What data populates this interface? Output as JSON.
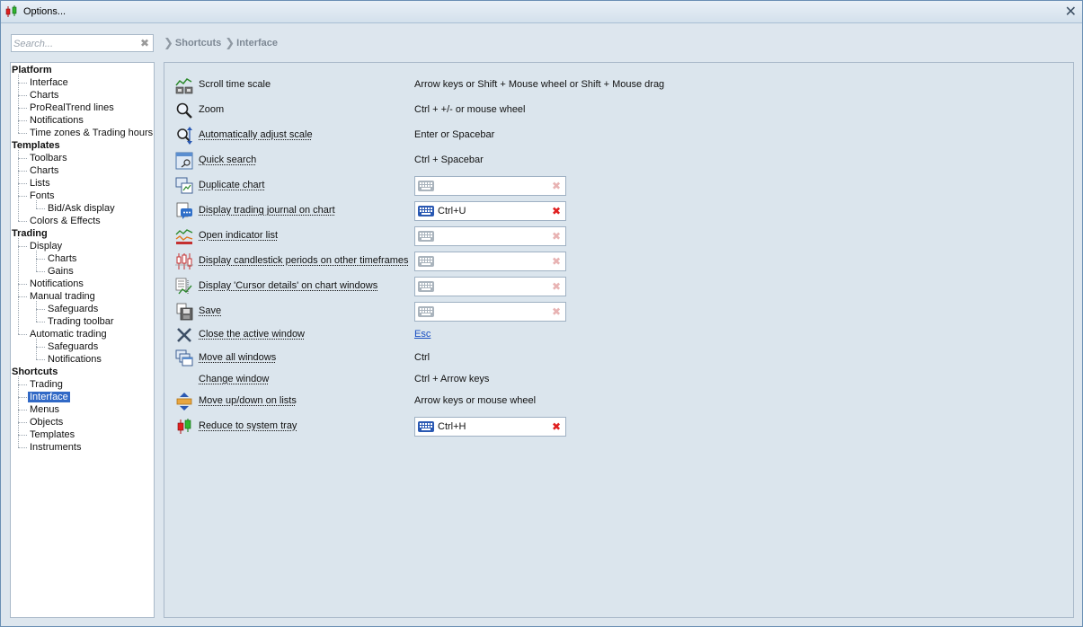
{
  "window": {
    "title": "Options..."
  },
  "search": {
    "placeholder": "Search..."
  },
  "breadcrumb": [
    "Shortcuts",
    "Interface"
  ],
  "tree": [
    {
      "label": "Platform",
      "level": 0
    },
    {
      "label": "Interface",
      "level": 1
    },
    {
      "label": "Charts",
      "level": 1
    },
    {
      "label": "ProRealTrend lines",
      "level": 1
    },
    {
      "label": "Notifications",
      "level": 1
    },
    {
      "label": "Time zones & Trading hours",
      "level": 1
    },
    {
      "label": "Templates",
      "level": 0
    },
    {
      "label": "Toolbars",
      "level": 1
    },
    {
      "label": "Charts",
      "level": 1
    },
    {
      "label": "Lists",
      "level": 1
    },
    {
      "label": "Fonts",
      "level": 1
    },
    {
      "label": "Bid/Ask display",
      "level": 2
    },
    {
      "label": "Colors & Effects",
      "level": 1
    },
    {
      "label": "Trading",
      "level": 0
    },
    {
      "label": "Display",
      "level": 1
    },
    {
      "label": "Charts",
      "level": 2
    },
    {
      "label": "Gains",
      "level": 2
    },
    {
      "label": "Notifications",
      "level": 1
    },
    {
      "label": "Manual trading",
      "level": 1
    },
    {
      "label": "Safeguards",
      "level": 2
    },
    {
      "label": "Trading toolbar",
      "level": 2
    },
    {
      "label": "Automatic trading",
      "level": 1
    },
    {
      "label": "Safeguards",
      "level": 2
    },
    {
      "label": "Notifications",
      "level": 2
    },
    {
      "label": "Shortcuts",
      "level": 0
    },
    {
      "label": "Trading",
      "level": 1
    },
    {
      "label": "Interface",
      "level": 1,
      "selected": true
    },
    {
      "label": "Menus",
      "level": 1
    },
    {
      "label": "Objects",
      "level": 1
    },
    {
      "label": "Templates",
      "level": 1
    },
    {
      "label": "Instruments",
      "level": 1
    }
  ],
  "shortcuts": [
    {
      "label": "Scroll time scale",
      "link": false,
      "icon": "scroll-time-scale-icon",
      "value": "Arrow keys or Shift + Mouse wheel or Shift + Mouse drag",
      "type": "text"
    },
    {
      "label": "Zoom",
      "link": false,
      "icon": "magnifier-icon",
      "value": "Ctrl + +/- or mouse wheel",
      "type": "text"
    },
    {
      "label": "Automatically adjust scale",
      "link": true,
      "icon": "auto-scale-icon",
      "value": "Enter or Spacebar",
      "type": "text"
    },
    {
      "label": "Quick search",
      "link": true,
      "icon": "quick-search-icon",
      "value": "Ctrl + Spacebar",
      "type": "text"
    },
    {
      "label": "Duplicate chart",
      "link": true,
      "icon": "duplicate-chart-icon",
      "value": "",
      "type": "field"
    },
    {
      "label": "Display trading journal on chart",
      "link": true,
      "icon": "journal-icon",
      "value": "Ctrl+U",
      "type": "field"
    },
    {
      "label": "Open indicator list",
      "link": true,
      "icon": "indicator-icon",
      "value": "",
      "type": "field"
    },
    {
      "label": "Display candlestick periods on other timeframes",
      "link": true,
      "icon": "candlestick-periods-icon",
      "value": "",
      "type": "field"
    },
    {
      "label": "Display 'Cursor details' on chart windows",
      "link": true,
      "icon": "cursor-details-icon",
      "value": "",
      "type": "field"
    },
    {
      "label": "Save",
      "link": true,
      "icon": "save-icon",
      "value": "",
      "type": "field"
    },
    {
      "label": "Close the active window",
      "link": true,
      "icon": "close-window-icon",
      "value": "Esc",
      "type": "esc"
    },
    {
      "label": "Move all windows",
      "link": true,
      "icon": "move-windows-icon",
      "value": "Ctrl",
      "type": "text"
    },
    {
      "label": "Change window",
      "link": true,
      "icon": "",
      "value": "Ctrl + Arrow keys",
      "type": "text"
    },
    {
      "label": "Move up/down on lists",
      "link": true,
      "icon": "move-up-down-icon",
      "value": "Arrow keys or mouse wheel",
      "type": "text"
    },
    {
      "label": "Reduce to system tray",
      "link": true,
      "icon": "system-tray-icon",
      "value": "Ctrl+H",
      "type": "field"
    }
  ],
  "colors": {
    "accent": "#3169c6",
    "delete_active": "#e02020",
    "link": "#1a4fc2"
  }
}
